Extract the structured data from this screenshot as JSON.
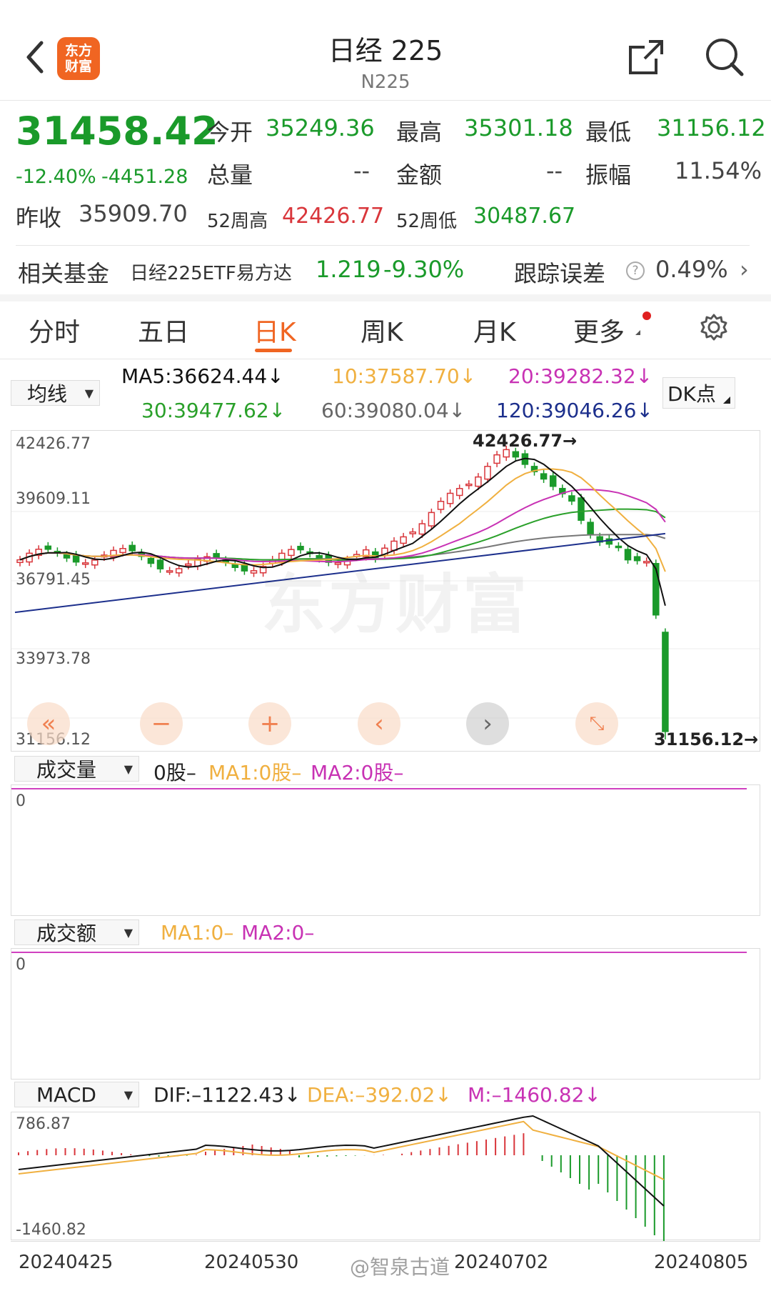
{
  "header": {
    "title": "日经 225",
    "code": "N225",
    "logo_text_1": "东方",
    "logo_text_2": "财富"
  },
  "quote": {
    "price": "31458.42",
    "change_pct": "-12.40%",
    "change": "-4451.28",
    "prev_close_label": "昨收",
    "prev_close": "35909.70",
    "open_label": "今开",
    "open": "35249.36",
    "high_label": "最高",
    "high": "35301.18",
    "low_label": "最低",
    "low": "31156.12",
    "volume_label": "总量",
    "volume": "--",
    "amount_label": "金额",
    "amount": "--",
    "amplitude_label": "振幅",
    "amplitude": "11.54%",
    "w52_high_label": "52周高",
    "w52_high": "42426.77",
    "w52_low_label": "52周低",
    "w52_low": "30487.67"
  },
  "fund": {
    "label": "相关基金",
    "name": "日经225ETF易方达",
    "price": "1.219",
    "change": "-9.30%",
    "tracking_label": "跟踪误差",
    "tracking_value": "0.49%"
  },
  "tabs": [
    {
      "label": "分时",
      "active": false
    },
    {
      "label": "五日",
      "active": false
    },
    {
      "label": "日K",
      "active": true
    },
    {
      "label": "周K",
      "active": false
    },
    {
      "label": "月K",
      "active": false
    },
    {
      "label": "更多",
      "active": false
    }
  ],
  "ma_bar": {
    "selector": "均线",
    "ma5": "MA5:36624.44↓",
    "ma10": "10:37587.70↓",
    "ma20": "20:39282.32↓",
    "ma30": "30:39477.62↓",
    "ma60": "60:39080.04↓",
    "ma120": "120:39046.26↓",
    "dk": "DK点"
  },
  "kline": {
    "y_labels": [
      "42426.77",
      "39609.11",
      "36791.45",
      "33973.78",
      "31156.12"
    ],
    "max_marker": "42426.77→",
    "min_marker": "31156.12→",
    "watermark": "东方财富"
  },
  "volume": {
    "selector": "成交量",
    "value": "0股–",
    "ma1": "MA1:0股–",
    "ma2": "MA2:0股–",
    "zero": "0"
  },
  "amount": {
    "selector": "成交额",
    "ma1": "MA1:0–",
    "ma2": "MA2:0–",
    "zero": "0"
  },
  "macd": {
    "selector": "MACD",
    "dif": "DIF:–1122.43↓",
    "dea": "DEA:–392.02↓",
    "m": "M:–1460.82↓",
    "y_top": "786.87",
    "y_bottom": "-1460.82"
  },
  "x_axis": [
    "20240425",
    "20240530",
    "20240702",
    "20240805"
  ],
  "footer_watermark": "@智泉古道",
  "colors": {
    "up": "#d9363b",
    "down": "#1a9a2a",
    "accent": "#f06522",
    "ma5": "#111111",
    "ma10": "#f0b040",
    "ma20": "#c832b4",
    "ma30": "#2aa02a",
    "ma60": "#777777",
    "ma120": "#1c2f8c"
  }
}
